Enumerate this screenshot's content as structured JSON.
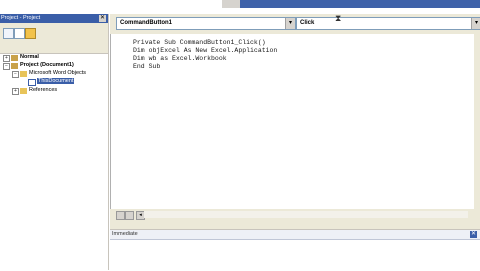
{
  "project": {
    "title": "Project - Project",
    "close": "✕",
    "tree": {
      "normal": "Normal",
      "project": "Project (Document1)",
      "word_objects": "Microsoft Word Objects",
      "this_document": "ThisDocument",
      "references": "References"
    }
  },
  "code": {
    "object_combo": "CommandButton1",
    "proc_combo": "Click",
    "lines": [
      "Private Sub CommandButton1_Click()",
      "Dim objExcel As New Excel.Application",
      "Dim wb as Excel.Workbook",
      "End Sub"
    ]
  },
  "immediate": {
    "title": "Immediate",
    "close": "✕"
  },
  "colors": {
    "title_blue": "#3a5ea8",
    "toolbar_bg": "#ece9d8"
  }
}
